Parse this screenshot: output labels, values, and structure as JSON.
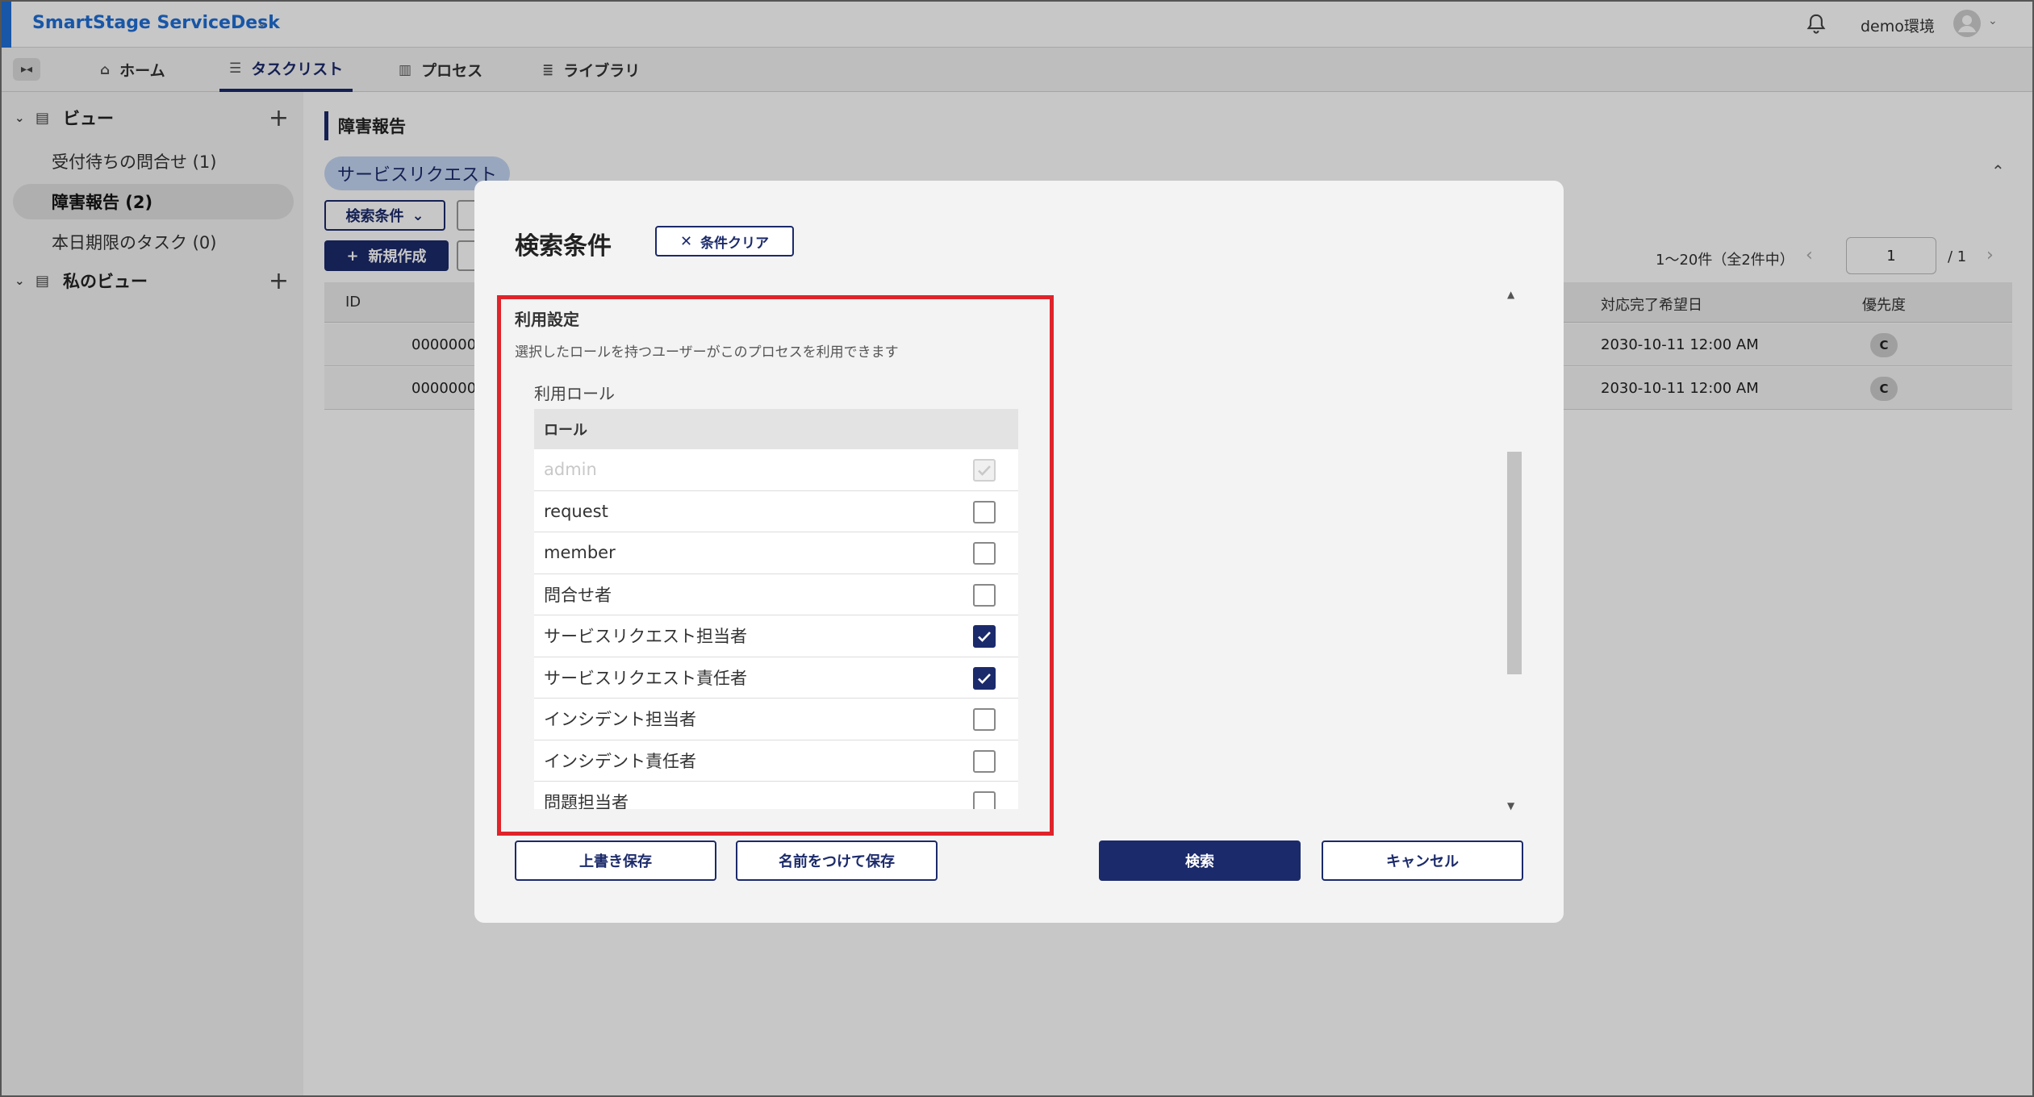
{
  "app": {
    "title": "SmartStage ServiceDesk",
    "env_label": "demo環境",
    "accent_color": "#1f6fd6",
    "primary_color": "#1b2a6b",
    "highlight_color": "#e0232a"
  },
  "nav": {
    "tabs": [
      {
        "label": "ホーム",
        "icon": "home-icon",
        "active": false
      },
      {
        "label": "タスクリスト",
        "icon": "checklist-icon",
        "active": true
      },
      {
        "label": "プロセス",
        "icon": "process-icon",
        "active": false
      },
      {
        "label": "ライブラリ",
        "icon": "library-icon",
        "active": false
      }
    ]
  },
  "sidebar": {
    "views_header": "ビュー",
    "my_views_header": "私のビュー",
    "items": [
      {
        "label": "受付待ちの問合せ (1)",
        "active": false
      },
      {
        "label": "障害報告 (2)",
        "active": true
      },
      {
        "label": "本日期限のタスク (0)",
        "active": false
      }
    ]
  },
  "main": {
    "title": "障害報告",
    "chip": "サービスリクエスト",
    "search_button": "検索条件",
    "new_button": "新規作成",
    "pager": {
      "range": "1～20件（全2件中）",
      "page": "1",
      "total": "/ 1"
    },
    "columns": [
      "ID",
      "対応完了希望日",
      "優先度"
    ],
    "rows": [
      {
        "id": "0000000",
        "due": "2030-10-11 12:00 AM",
        "priority": "C"
      },
      {
        "id": "0000000",
        "due": "2030-10-11 12:00 AM",
        "priority": "C"
      }
    ]
  },
  "modal": {
    "title": "検索条件",
    "clear_button": "条件クリア",
    "section_title": "利用設定",
    "section_desc": "選択したロールを持つユーザーがこのプロセスを利用できます",
    "role_label": "利用ロール",
    "role_column": "ロール",
    "roles": [
      {
        "name": "admin",
        "checked": true,
        "disabled": true
      },
      {
        "name": "request",
        "checked": false,
        "disabled": false
      },
      {
        "name": "member",
        "checked": false,
        "disabled": false
      },
      {
        "name": "問合せ者",
        "checked": false,
        "disabled": false
      },
      {
        "name": "サービスリクエスト担当者",
        "checked": true,
        "disabled": false
      },
      {
        "name": "サービスリクエスト責任者",
        "checked": true,
        "disabled": false
      },
      {
        "name": "インシデント担当者",
        "checked": false,
        "disabled": false
      },
      {
        "name": "インシデント責任者",
        "checked": false,
        "disabled": false
      },
      {
        "name": "問題担当者",
        "checked": false,
        "disabled": false
      }
    ],
    "buttons": {
      "overwrite": "上書き保存",
      "save_as": "名前をつけて保存",
      "search": "検索",
      "cancel": "キャンセル"
    }
  }
}
